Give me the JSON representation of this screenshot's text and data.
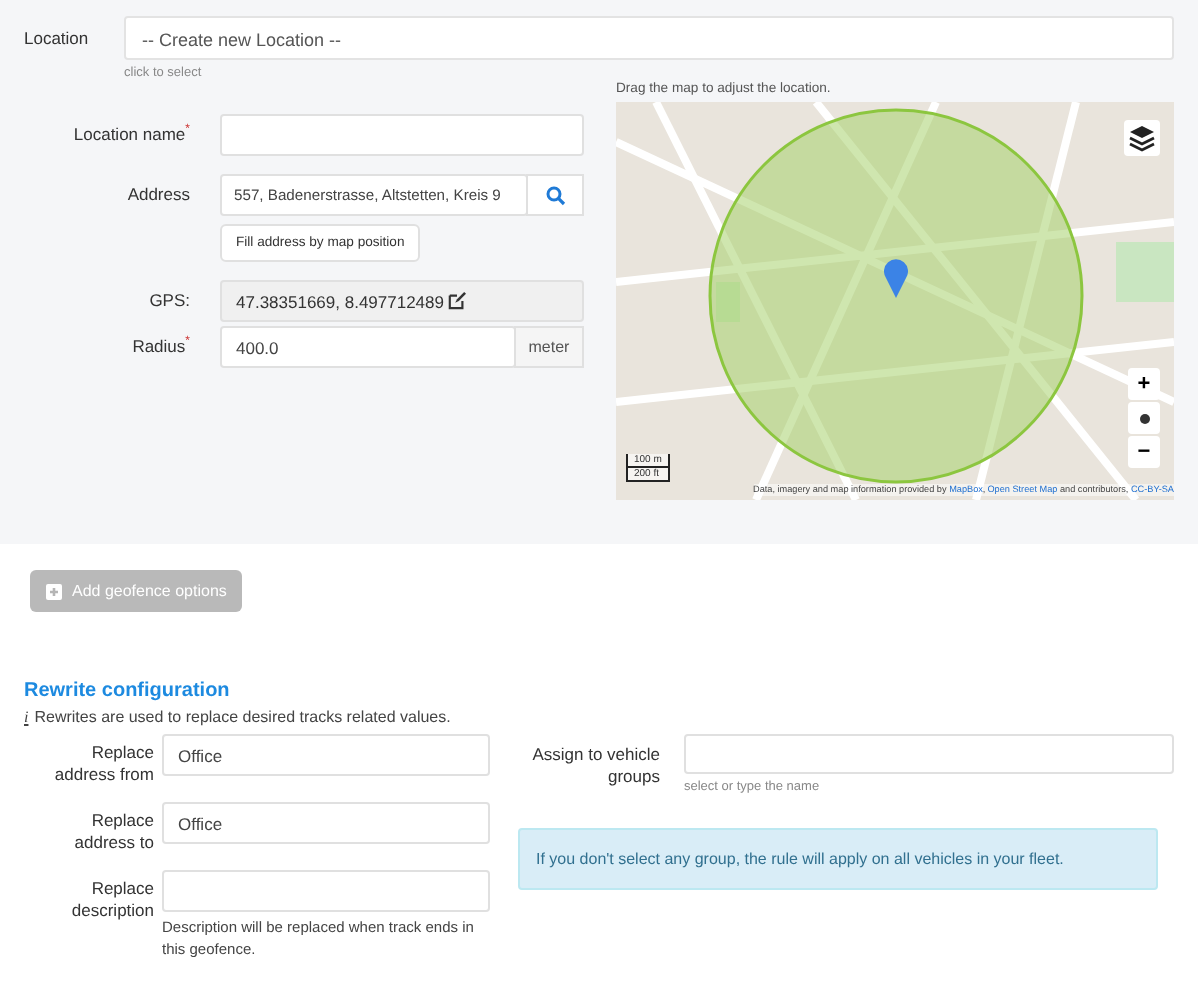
{
  "location": {
    "label": "Location",
    "value": "-- Create new Location --",
    "hint": "click to select"
  },
  "fields": [
    {
      "kind": "text",
      "label": "Location name",
      "mark": "*"
    },
    {
      "kind": "address",
      "label": "Address",
      "value": "557, Badenerstrasse, Altstetten, Kreis 9",
      "button": "Fill address by map position"
    },
    {
      "kind": "gps",
      "label": "GPS:",
      "value": "47.38351669, 8.497712489"
    },
    {
      "kind": "unit",
      "label": "Radius",
      "mark": "*",
      "value": "400.0",
      "unit": "meter"
    }
  ],
  "map": {
    "hint": "Drag the map to adjust the location.",
    "zoom_in": "+",
    "zoom_out": "−",
    "scale": [
      "100 m",
      "200 ft"
    ],
    "attribution": [
      {
        "text": "Data, imagery and map information provided by ",
        "link": false
      },
      {
        "text": "MapBox",
        "link": true,
        "suffix": ","
      },
      {
        "text": "Open Street Map",
        "link": true
      },
      {
        "text": " and contributors, ",
        "link": false
      },
      {
        "text": "CC-BY-SA",
        "link": true
      }
    ]
  },
  "geofence_button": {
    "label": "Add geofence options",
    "disabled": true
  },
  "rewrite": {
    "title": "Rewrite configuration",
    "info_icon": "i",
    "info": "Rewrites are used to replace desired tracks related values.",
    "fields": [
      {
        "label": "Replace address from",
        "value": "Office"
      },
      {
        "label": "Replace address to",
        "value": "Office"
      },
      {
        "label": "Replace description",
        "help": "Description will be replaced when track ends in this geofence."
      }
    ],
    "groups": {
      "label": "Assign to vehicle groups",
      "hint": "select or type the name"
    },
    "alert": "If you don't select any group, the rule will apply on all vehicles in your fleet."
  }
}
